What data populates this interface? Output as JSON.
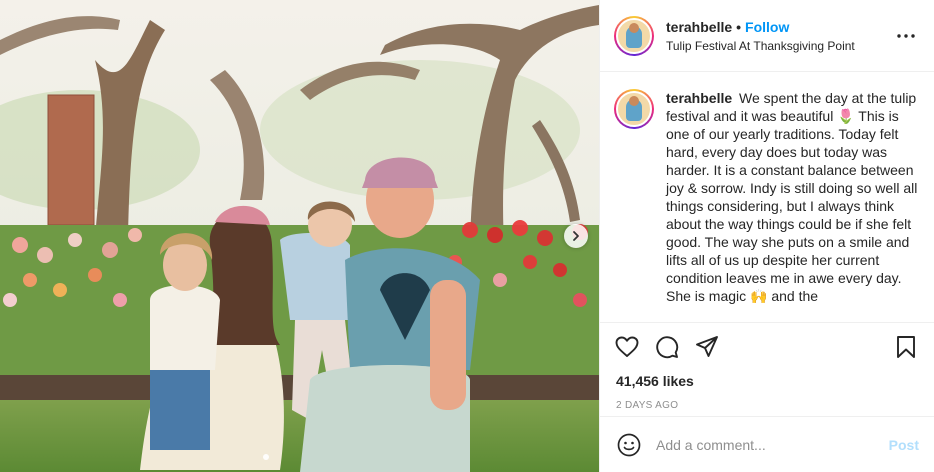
{
  "photo": {
    "alt_icon": "tulip-photo",
    "next_icon": "chevron-right-icon"
  },
  "header": {
    "username": "terahbelle",
    "separator": "•",
    "follow_label": "Follow",
    "location": "Tulip Festival At Thanksgiving Point",
    "more_icon": "more-horizontal-icon"
  },
  "caption": {
    "username": "terahbelle",
    "text": "We spent the day at the tulip festival and it was beautiful 🌷 This is one of our yearly traditions. Today felt hard, every day does but today was harder. It is a constant balance between joy & sorrow. Indy is still doing so well all things considering, but I always think about the way things could be if she felt good. The way she puts on a smile and lifts all of us up despite her current condition leaves me in awe every day. She is magic 🙌 and the"
  },
  "actions": {
    "like_icon": "heart-icon",
    "comment_icon": "comment-icon",
    "share_icon": "share-icon",
    "save_icon": "bookmark-icon"
  },
  "likes": "41,456 likes",
  "timestamp": "2 DAYS AGO",
  "comment": {
    "emoji_icon": "smiley-icon",
    "placeholder": "Add a comment...",
    "post_label": "Post"
  },
  "colors": {
    "accent": "#0095f6",
    "post_disabled": "#b2dffc",
    "muted": "#8e8e8e",
    "text": "#262626"
  }
}
